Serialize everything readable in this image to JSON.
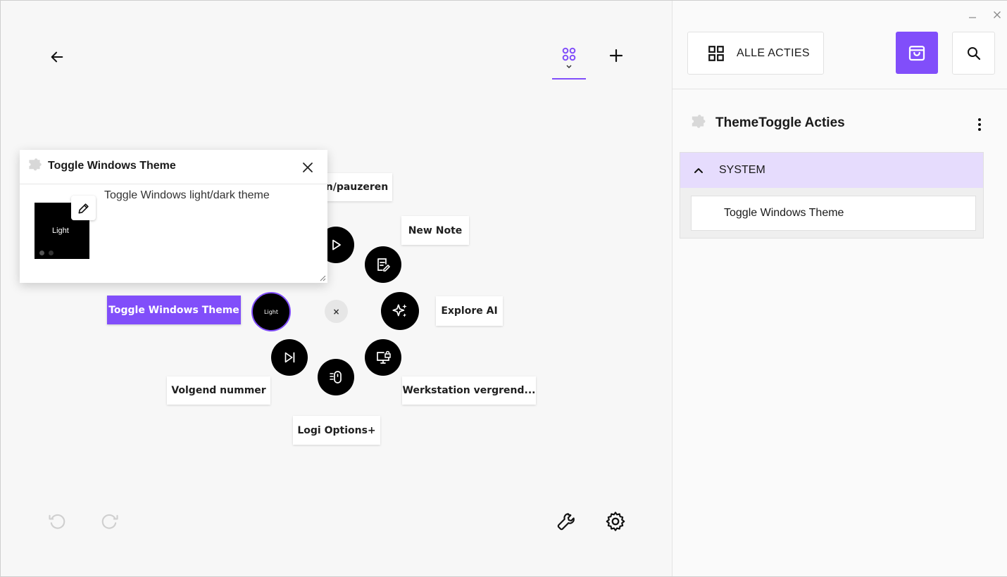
{
  "window": {
    "minimize_icon": "minimize-icon",
    "close_icon": "close-icon"
  },
  "toolbar": {
    "back_icon": "arrow-left-icon",
    "tab_icon": "grid-dots-icon",
    "add_icon": "plus-icon"
  },
  "radial": {
    "center_close": "×",
    "center_profile_label": "Light",
    "items": [
      {
        "label": "n/pauzeren",
        "icon": "play-icon"
      },
      {
        "label": "New Note",
        "icon": "note-edit-icon"
      },
      {
        "label": "Explore AI",
        "icon": "sparkles-icon"
      },
      {
        "label": "Werkstation vergrend...",
        "icon": "monitor-lock-icon"
      },
      {
        "label": "Logi Options+",
        "icon": "mouse-icon"
      },
      {
        "label": "Volgend nummer",
        "icon": "skip-next-icon"
      }
    ],
    "selected_label": "Toggle Windows Theme"
  },
  "popup": {
    "title": "Toggle Windows Theme",
    "description": "Toggle Windows light/dark theme",
    "thumb_label": "Light"
  },
  "bottom": {
    "undo_icon": "undo-icon",
    "redo_icon": "redo-icon",
    "wrench_icon": "wrench-icon",
    "gear_icon": "gear-icon"
  },
  "sidebar": {
    "all_actions_label": "ALLE ACTIES",
    "plugin_title": "ThemeToggle Acties",
    "section_label": "SYSTEM",
    "items": [
      {
        "label": "Toggle Windows Theme"
      }
    ]
  },
  "colors": {
    "accent": "#814efa",
    "section_bg": "#e6dcfd"
  }
}
